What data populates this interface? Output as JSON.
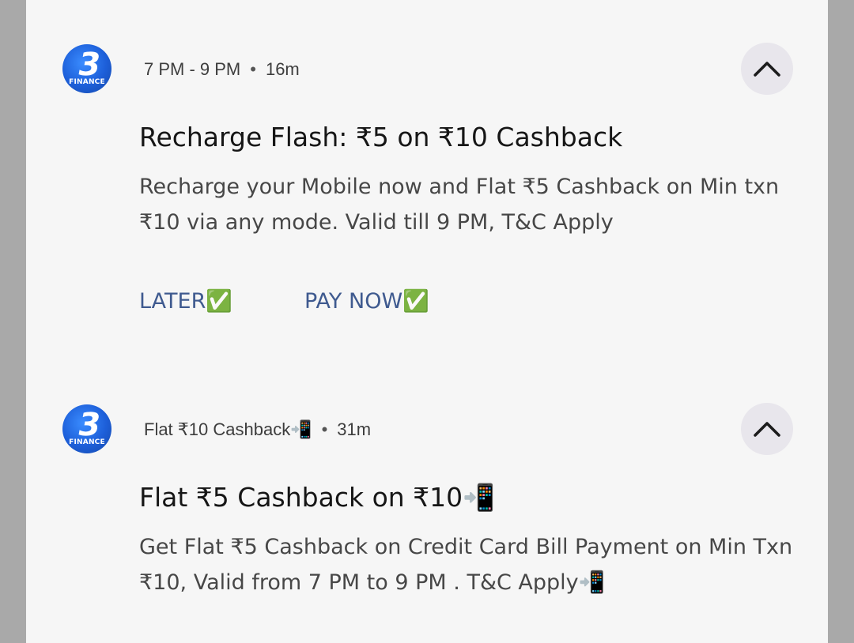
{
  "notifications": [
    {
      "app_icon": {
        "mark": "3",
        "label": "FINANCE"
      },
      "meta": {
        "subtext": "7 PM - 9 PM",
        "separator": "•",
        "time": "16m"
      },
      "title": "Recharge Flash: ₹5 on ₹10 Cashback",
      "body": "Recharge your Mobile now and Flat ₹5 Cashback on Min txn ₹10 via any mode. Valid till 9 PM, T&C Apply",
      "actions": [
        {
          "label": "LATER✅"
        },
        {
          "label": "PAY NOW✅"
        }
      ],
      "collapse_icon": "chevron-up-icon"
    },
    {
      "app_icon": {
        "mark": "3",
        "label": "FINANCE"
      },
      "meta": {
        "subtext": "Flat ₹10 Cashback📲",
        "separator": "•",
        "time": "31m"
      },
      "title": "Flat ₹5 Cashback on ₹10📲",
      "body": "Get Flat ₹5 Cashback on Credit Card Bill Payment on Min Txn ₹10, Valid from 7 PM to 9 PM . T&C Apply📲",
      "collapse_icon": "chevron-up-icon"
    }
  ],
  "colors": {
    "outer_background": "#a9a9a9",
    "panel_background": "#f6f6f6",
    "action_text": "#3f5a8f",
    "icon_blue": "#1d5fd9",
    "collapse_button": "#e8e6ec"
  }
}
